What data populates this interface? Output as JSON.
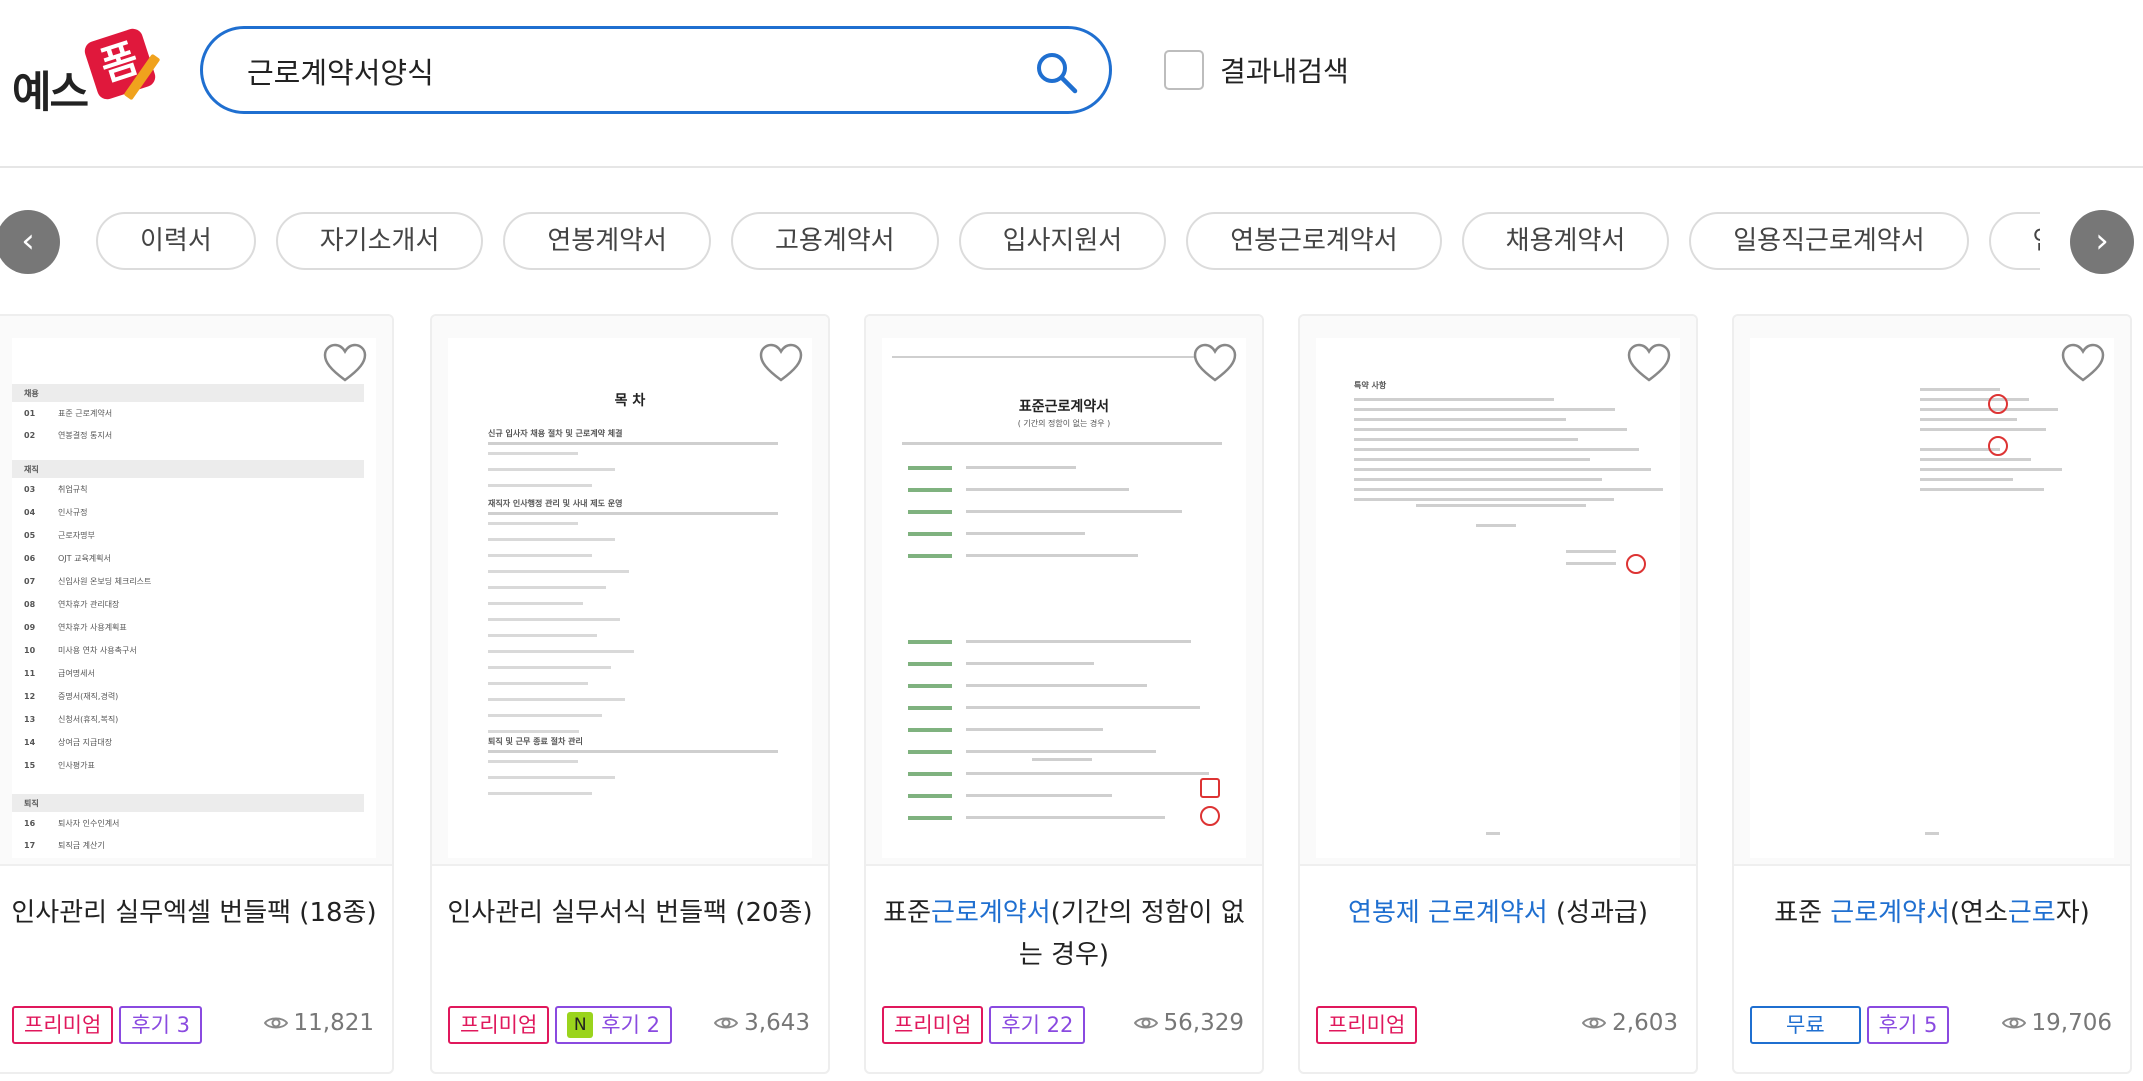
{
  "brand": {
    "logo_text": "예스",
    "logo_badge": "폼"
  },
  "search": {
    "value": "근로계약서양식",
    "within_label": "결과내검색"
  },
  "keywords": [
    "이력서",
    "자기소개서",
    "연봉계약서",
    "고용계약서",
    "입사지원서",
    "연봉근로계약서",
    "채용계약서",
    "일용직근로계약서",
    "연봉제근로계약서"
  ],
  "nav": {
    "prev": "‹",
    "next": "›"
  },
  "products": [
    {
      "title": "인사관리 실무엑셀 번들팩 (18종)",
      "tags": {
        "premium": "프리미엄",
        "review": "후기 3"
      },
      "views": "11,821"
    },
    {
      "title": "인사관리 실무서식 번들팩 (20종)",
      "tags": {
        "premium": "프리미엄",
        "new": "N",
        "review": "후기 2"
      },
      "views": "3,643"
    },
    {
      "title_parts": [
        "표준",
        "근로계약서",
        "(기간의 정함이 없는 경우)"
      ],
      "tags": {
        "premium": "프리미엄",
        "review": "후기 22"
      },
      "views": "56,329"
    },
    {
      "title_parts": [
        "연봉제 근로계약서",
        " (성과급)"
      ],
      "tags": {
        "premium": "프리미엄"
      },
      "views": "2,603"
    },
    {
      "title_parts": [
        "표준 ",
        "근로계약서",
        "(연소",
        "근로",
        "자)"
      ],
      "tags": {
        "free": "무료",
        "review": "후기 5"
      },
      "views": "19,706"
    }
  ],
  "thumbs": {
    "p1": {
      "sections": [
        "채용",
        "재직",
        "퇴직"
      ],
      "items": [
        [
          "01",
          "표준 근로계약서"
        ],
        [
          "02",
          "연봉결정 통지서"
        ],
        [
          "03",
          "취업규칙"
        ],
        [
          "04",
          "인사규정"
        ],
        [
          "05",
          "근로자명부"
        ],
        [
          "06",
          "OJT 교육계획서"
        ],
        [
          "07",
          "신입사원 온보딩 체크리스트"
        ],
        [
          "08",
          "연차휴가 관리대장"
        ],
        [
          "09",
          "연차휴가 사용계획표"
        ],
        [
          "10",
          "미사용 연차 사용촉구서"
        ],
        [
          "11",
          "급여명세서"
        ],
        [
          "12",
          "증명서(재직,경력)"
        ],
        [
          "13",
          "신청서(휴직,복직)"
        ],
        [
          "14",
          "상여금 지급대장"
        ],
        [
          "15",
          "인사평가표"
        ],
        [
          "16",
          "퇴사자 인수인계서"
        ],
        [
          "17",
          "퇴직금 계산기"
        ]
      ]
    },
    "p2": {
      "title": "목 차",
      "sections": [
        "신규 입사자 채용 절차 및 근로계약 체결",
        "재직자 인사행정 관리 및 사내 제도 운영",
        "퇴직 및 근무 종료 절차 관리"
      ]
    },
    "p3": {
      "title": "표준근로계약서",
      "subtitle": "( 기간의 정함이 없는 경우 )"
    },
    "p4": {
      "title": "특약 사항"
    }
  }
}
